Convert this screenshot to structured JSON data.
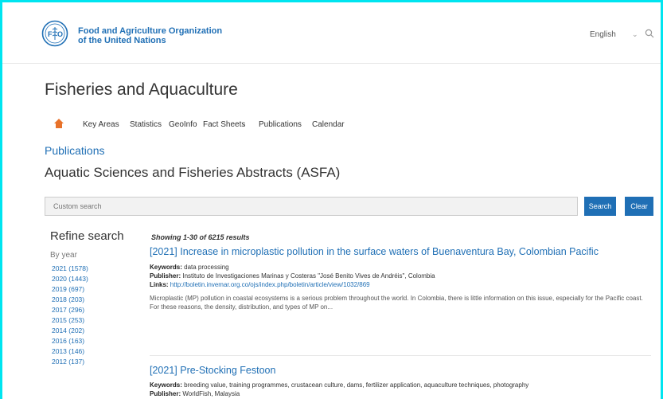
{
  "header": {
    "org_line1": "Food and Agriculture Organization",
    "org_line2": "of the United Nations",
    "language": "English",
    "logo_icon": "fao-logo-icon",
    "search_icon": "search-icon"
  },
  "section_title": "Fisheries and Aquaculture",
  "nav": {
    "home_icon": "home-icon",
    "items": [
      "Key Areas",
      "Statistics",
      "GeoInfo",
      "Fact Sheets",
      "Publications",
      "Calendar"
    ]
  },
  "breadcrumb": "Publications",
  "page_title": "Aquatic Sciences and Fisheries Abstracts (ASFA)",
  "search": {
    "placeholder": "Custom search",
    "search_label": "Search",
    "clear_label": "Clear"
  },
  "sidebar": {
    "title": "Refine search",
    "by_year": "By year",
    "years": [
      "2021 (1578)",
      "2020 (1443)",
      "2019 (697)",
      "2018 (203)",
      "2017 (296)",
      "2015 (253)",
      "2014 (202)",
      "2016 (163)",
      "2013 (146)",
      "2012 (137)"
    ]
  },
  "results": {
    "showing": "Showing 1-30 of 6215 results",
    "items": [
      {
        "title": "[2021] Increase in microplastic pollution in the surface waters of Buenaventura Bay, Colombian Pacific",
        "keywords_label": "Keywords:",
        "keywords": "data processing",
        "publisher_label": "Publisher:",
        "publisher": "Instituto de Investigaciones Marinas y Costeras \"José Benito Vives de Andréis\", Colombia",
        "links_label": "Links:",
        "link": "http://boletin.invemar.org.co/ojs/index.php/boletin/article/view/1032/869",
        "abstract": "Microplastic (MP) pollution in coastal ecosystems is a serious problem throughout the world. In Colombia, there is little information on this issue, especially for the Pacific coast. For these reasons, the density, distribution, and types of MP on..."
      },
      {
        "title": "[2021] Pre-Stocking Festoon",
        "keywords_label": "Keywords:",
        "keywords": "breeding value, training programmes, crustacean culture, dams, fertilizer application, aquaculture techniques, photography",
        "publisher_label": "Publisher:",
        "publisher": "WorldFish, Malaysia"
      }
    ]
  },
  "colors": {
    "accent": "#1f6fb5",
    "frame": "#00e5f0",
    "home_icon": "#e8722a"
  }
}
